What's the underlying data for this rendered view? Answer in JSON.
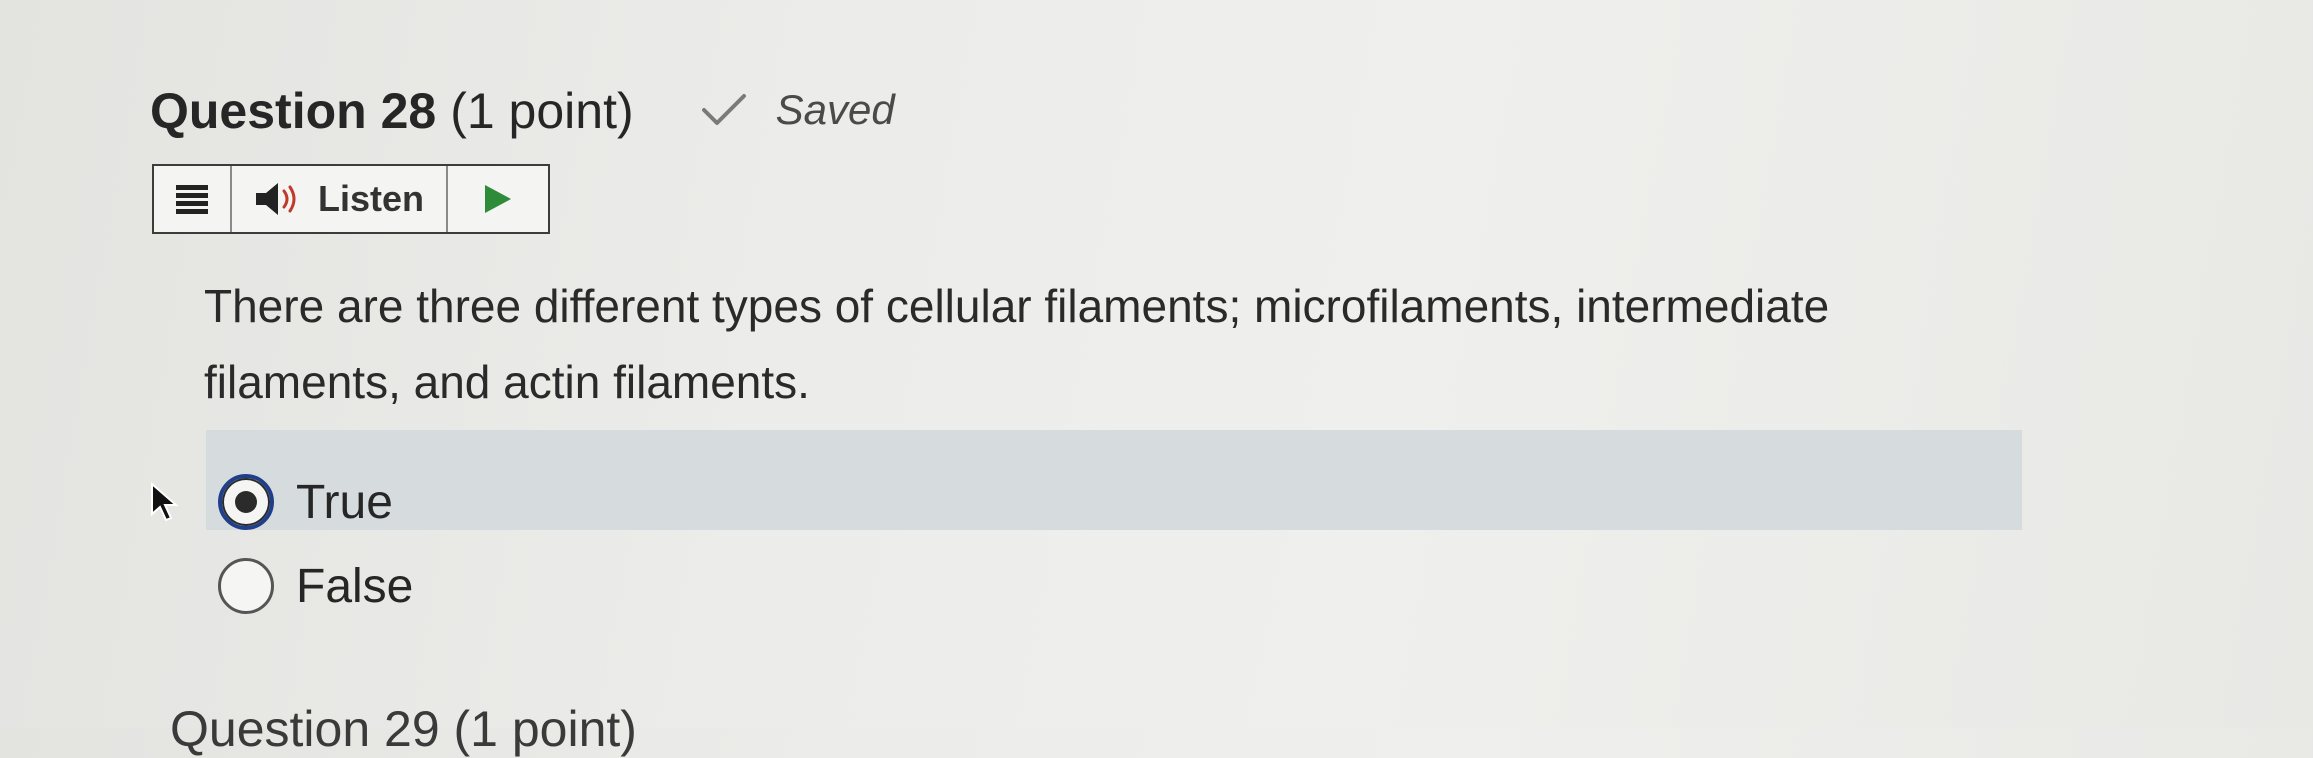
{
  "question": {
    "title": "Question 28",
    "points": "(1 point)",
    "status": "Saved",
    "text": "There are three different types of cellular filaments; microfilaments, intermediate filaments, and actin filaments."
  },
  "toolbar": {
    "menu_icon": "menu-icon",
    "listen_label": "Listen",
    "speaker_icon": "speaker-icon",
    "play_icon": "play-icon"
  },
  "options": [
    {
      "label": "True",
      "selected": true
    },
    {
      "label": "False",
      "selected": false
    }
  ],
  "next_question": {
    "title": "Question 29 (1 point)"
  },
  "colors": {
    "radio_selected_ring": "#1f3f8a",
    "highlight_band": "#d6dbde",
    "play_green": "#2e8b3a"
  }
}
